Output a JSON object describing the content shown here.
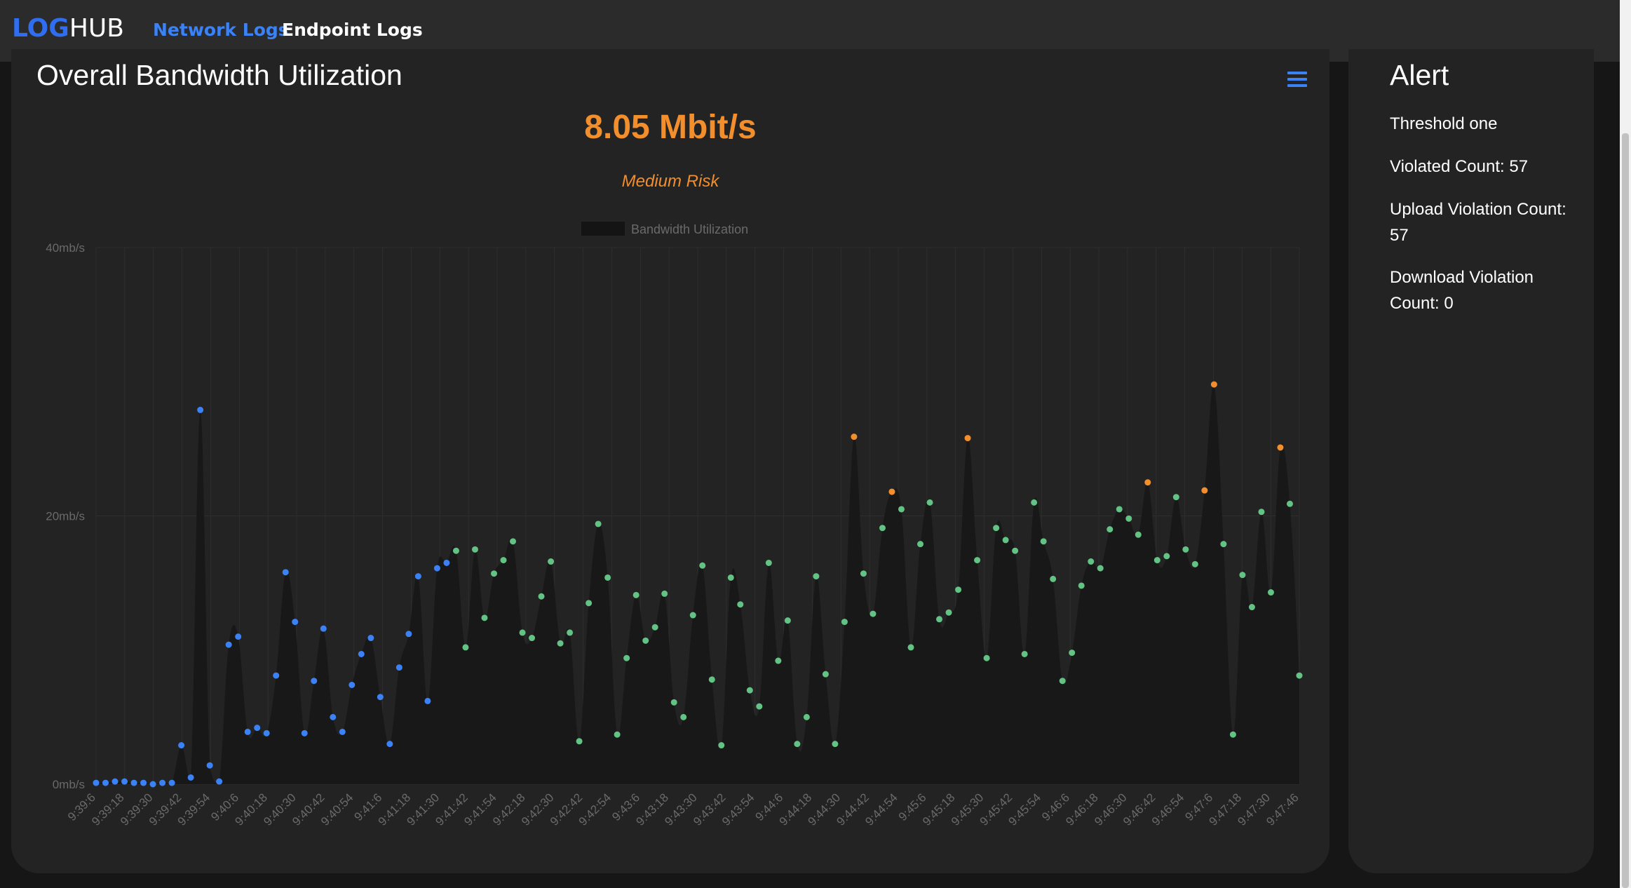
{
  "app": {
    "logo_part1": "LOG",
    "logo_part2": "HUB",
    "nav": {
      "network_logs": "Network Logs",
      "endpoint_logs": "Endpoint Logs"
    }
  },
  "panel": {
    "title": "Overall Bandwidth Utilization",
    "current_value": "8.05 Mbit/s",
    "risk_label": "Medium Risk",
    "menu_icon": "hamburger-menu-icon"
  },
  "alert": {
    "title": "Alert",
    "threshold": "Threshold one",
    "violated": "Violated Count: 57",
    "upload": "Upload Violation Count: 57",
    "download": "Download Violation Count: 0"
  },
  "colors": {
    "accent_blue": "#3b82f6",
    "risk_orange": "#f28e2b",
    "point_green": "#63c384",
    "area_fill": "#181818"
  },
  "chart_data": {
    "type": "area",
    "legend": [
      "Bandwidth Utilization"
    ],
    "legend_position": "top-center",
    "grid": true,
    "ylim": [
      0,
      40
    ],
    "y_ticks": [
      "0mb/s",
      "20mb/s",
      "40mb/s"
    ],
    "x_tick_labels": [
      "9:39:6",
      "9:39:18",
      "9:39:30",
      "9:39:42",
      "9:39:54",
      "9:40:6",
      "9:40:18",
      "9:40:30",
      "9:40:42",
      "9:40:54",
      "9:41:6",
      "9:41:18",
      "9:41:30",
      "9:41:42",
      "9:41:54",
      "9:42:18",
      "9:42:30",
      "9:42:42",
      "9:42:54",
      "9:43:6",
      "9:43:18",
      "9:43:30",
      "9:43:42",
      "9:43:54",
      "9:44:6",
      "9:44:18",
      "9:44:30",
      "9:44:42",
      "9:44:54",
      "9:45:6",
      "9:45:18",
      "9:45:30",
      "9:45:42",
      "9:45:54",
      "9:46:6",
      "9:46:18",
      "9:46:30",
      "9:46:42",
      "9:46:54",
      "9:47:6",
      "9:47:18",
      "9:47:30",
      "9:47:46"
    ],
    "series": [
      {
        "name": "Bandwidth Utilization",
        "values": [
          0.1,
          0.1,
          0.2,
          0.2,
          0.1,
          0.1,
          0.0,
          0.1,
          0.1,
          2.9,
          0.5,
          27.9,
          1.4,
          0.2,
          10.4,
          11.0,
          3.9,
          4.2,
          3.8,
          8.1,
          15.8,
          12.1,
          3.8,
          7.7,
          11.6,
          5.0,
          3.9,
          7.4,
          9.7,
          10.9,
          6.5,
          3.0,
          8.7,
          11.2,
          15.5,
          6.2,
          16.1,
          16.5,
          17.4,
          10.2,
          17.5,
          12.4,
          15.7,
          16.7,
          18.1,
          11.3,
          10.9,
          14.0,
          16.6,
          10.5,
          11.3,
          3.2,
          13.5,
          19.4,
          15.4,
          3.7,
          9.4,
          14.1,
          10.7,
          11.7,
          14.2,
          6.1,
          5.0,
          12.6,
          16.3,
          7.8,
          2.9,
          15.4,
          13.4,
          7.0,
          5.8,
          16.5,
          9.2,
          12.2,
          3.0,
          5.0,
          15.5,
          8.2,
          3.0,
          12.1,
          25.9,
          15.7,
          12.7,
          19.1,
          21.8,
          20.5,
          10.2,
          17.9,
          21.0,
          12.3,
          12.8,
          14.5,
          25.8,
          16.7,
          9.4,
          19.1,
          18.2,
          17.4,
          9.7,
          21.0,
          18.1,
          15.3,
          7.7,
          9.8,
          14.8,
          16.6,
          16.1,
          19.0,
          20.5,
          19.8,
          18.6,
          22.5,
          16.7,
          17.0,
          21.4,
          17.5,
          16.4,
          21.9,
          29.8,
          17.9,
          3.7,
          15.6,
          13.2,
          20.3,
          14.3,
          25.1,
          20.9,
          8.1
        ]
      }
    ]
  }
}
